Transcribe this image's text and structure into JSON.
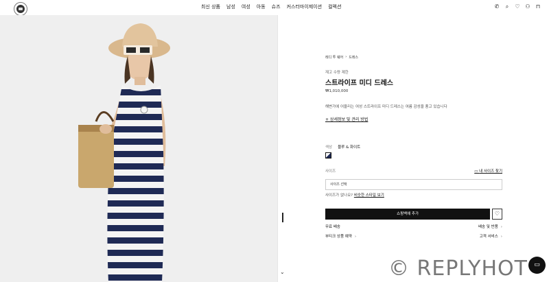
{
  "header": {
    "logo": "moncler-logo",
    "nav": [
      "최신 상품",
      "남성",
      "여성",
      "아동",
      "슈즈",
      "커스터마이제이션",
      "컬렉션"
    ],
    "utility_icons": [
      "phone-icon",
      "search-icon",
      "heart-icon",
      "user-icon",
      "bag-icon"
    ]
  },
  "product": {
    "breadcrumb": [
      "레디 투 웨어",
      "드레스"
    ],
    "eyebrow": "재고 수량 제한",
    "title": "스트라이프 미디 드레스",
    "price": "₩1,010,000",
    "description": "해변가에 어울리는 여성 스트라이프 미디 드레스는 여름 감성을 풍고 있습니다",
    "details_link": "+ 상세정보 및 관리 방법",
    "color_label": "색상",
    "color_value": "블루 & 화이트",
    "size_label": "사이즈",
    "size_guide": "내 사이즈 찾기",
    "size_placeholder": "사이즈 선택",
    "unavailable_text": "사이즈가 없나요?",
    "similar_styles": "비슷한 스타일 보기",
    "add_to_bag": "쇼핑백에 추가",
    "services": {
      "free_shipping": "무료 배송",
      "shipping_returns": "배송 및 반품",
      "boutique_reservation": "부티크 상품 예약",
      "customer_service": "고객 서비스"
    }
  },
  "watermark": "© REPLYHOT",
  "colors": {
    "accent": "#111111",
    "stripe_navy": "#1f2a55",
    "background": "#efefef"
  }
}
